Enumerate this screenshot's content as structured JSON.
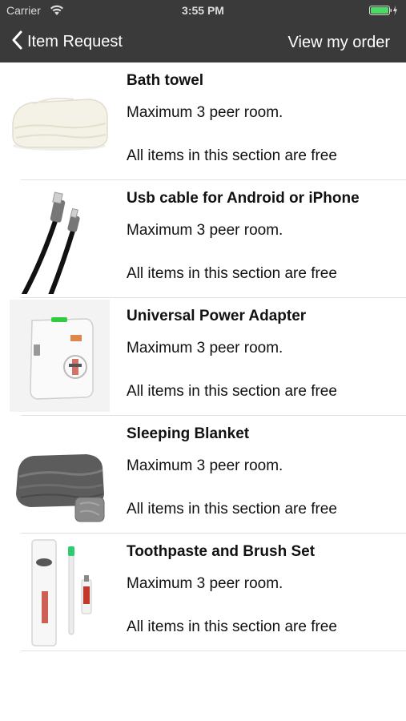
{
  "status_bar": {
    "carrier": "Carrier",
    "time": "3:55 PM",
    "wifi_icon": "wifi-icon",
    "battery_icon": "battery-charging-icon",
    "battery_color": "#4cd964"
  },
  "nav": {
    "back_icon": "chevron-left-icon",
    "back_label": "Item Request",
    "right_label": "View my order",
    "background": "#3a3a3a"
  },
  "items": [
    {
      "title": "Bath towel",
      "limit": "Maximum 3 peer room.",
      "note": "All items in this section are free",
      "image": "bath-towel-image"
    },
    {
      "title": "Usb cable for Android or iPhone",
      "limit": "Maximum 3 peer room.",
      "note": "All items in this section are free",
      "image": "usb-cable-image"
    },
    {
      "title": "Universal Power Adapter",
      "limit": "Maximum 3 peer room.",
      "note": "All items in this section are free",
      "image": "power-adapter-image"
    },
    {
      "title": "Sleeping Blanket",
      "limit": "Maximum 3 peer room.",
      "note": "All items in this section are free",
      "image": "blanket-image"
    },
    {
      "title": "Toothpaste and Brush Set",
      "limit": "Maximum 3 peer room.",
      "note": "All items in this section are free",
      "image": "toothpaste-brush-image"
    }
  ]
}
